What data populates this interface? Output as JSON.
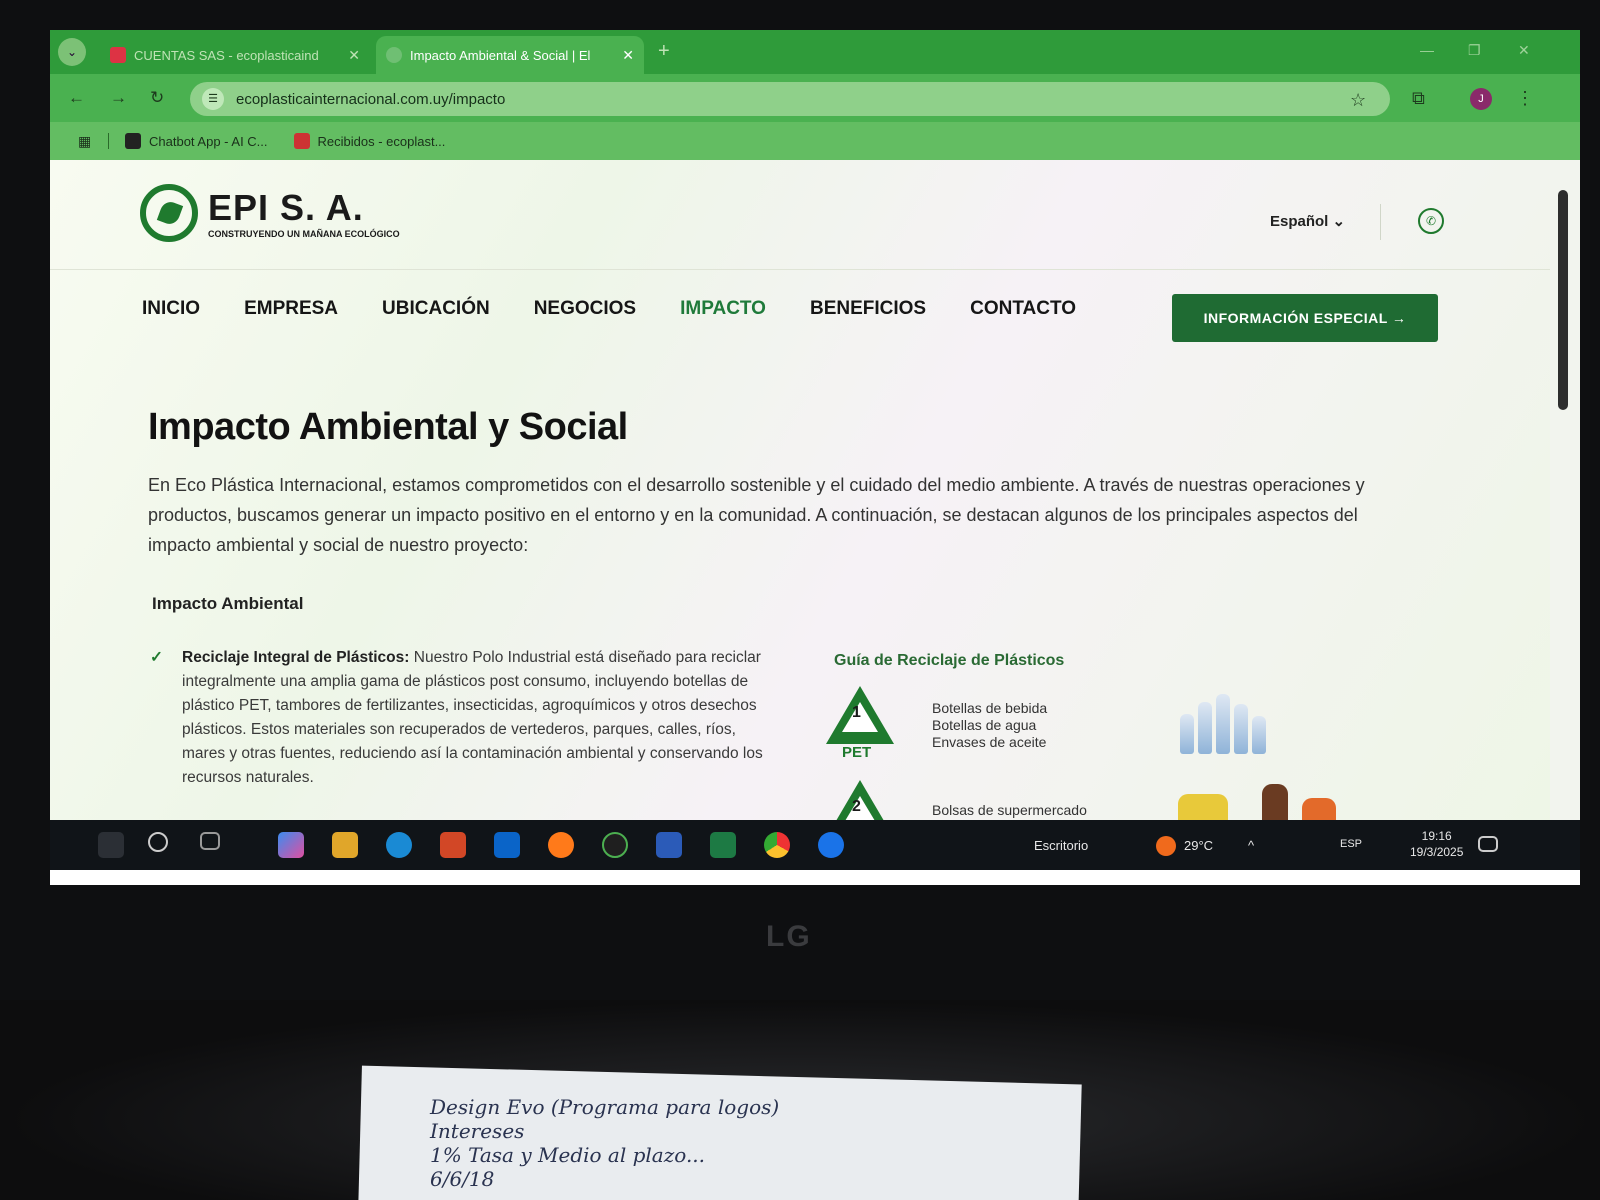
{
  "browser": {
    "tabs": [
      {
        "title": "CUENTAS SAS - ecoplasticaind",
        "active": false
      },
      {
        "title": "Impacto Ambiental & Social | El",
        "active": true
      }
    ],
    "url": "ecoplasticainternacional.com.uy/impacto",
    "bookmarks": [
      "Chatbot App - AI C...",
      "Recibidos - ecoplast..."
    ],
    "profile_initial": "J"
  },
  "site": {
    "logo_name": "EPI S. A.",
    "logo_tagline": "CONSTRUYENDO UN MAÑANA ECOLÓGICO",
    "language": "Español",
    "nav": [
      "INICIO",
      "EMPRESA",
      "UBICACIÓN",
      "NEGOCIOS",
      "IMPACTO",
      "BENEFICIOS",
      "CONTACTO"
    ],
    "active_nav": "IMPACTO",
    "cta": "INFORMACIÓN ESPECIAL →"
  },
  "content": {
    "title": "Impacto Ambiental y Social",
    "intro": "En Eco Plástica Internacional, estamos comprometidos con el desarrollo sostenible y el cuidado del medio ambiente. A través de nuestras operaciones y productos, buscamos generar un impacto positivo en el entorno y en la comunidad. A continuación, se destacan algunos de los principales aspectos del impacto ambiental y social de nuestro proyecto:",
    "section_title": "Impacto Ambiental",
    "bullet": {
      "title": "Reciclaje Integral de Plásticos:",
      "text": "Nuestro Polo Industrial está diseñado para reciclar integralmente una amplia gama de plásticos post consumo, incluyendo botellas de plástico PET, tambores de fertilizantes, insecticidas, agroquímicos y otros desechos plásticos. Estos materiales son recuperados de vertederos, parques, calles, ríos, mares y otras fuentes, reduciendo así la contaminación ambiental y conservando los recursos naturales."
    },
    "guide": {
      "title": "Guía de Reciclaje de Plásticos",
      "rows": [
        {
          "number": "1",
          "code": "PET",
          "items": [
            "Botellas de bebida",
            "Botellas de agua",
            "Envases de aceite"
          ]
        },
        {
          "number": "2",
          "code": "",
          "items": [
            "Bolsas de supermercado"
          ]
        }
      ]
    }
  },
  "taskbar": {
    "weather": "29°C",
    "lang": "ESP",
    "time": "19:16",
    "date": "19/3/2025",
    "desktop_label": "Escritorio"
  },
  "monitor_brand": "LG",
  "note": {
    "line1": "Design Evo (Programa para logos)",
    "line2": "Intereses",
    "line3": "1% Tasa y Medio al plazo...",
    "line4": "6/6/18"
  },
  "colors": {
    "brand_green": "#1f6b33",
    "browser_green": "#4ab150"
  }
}
